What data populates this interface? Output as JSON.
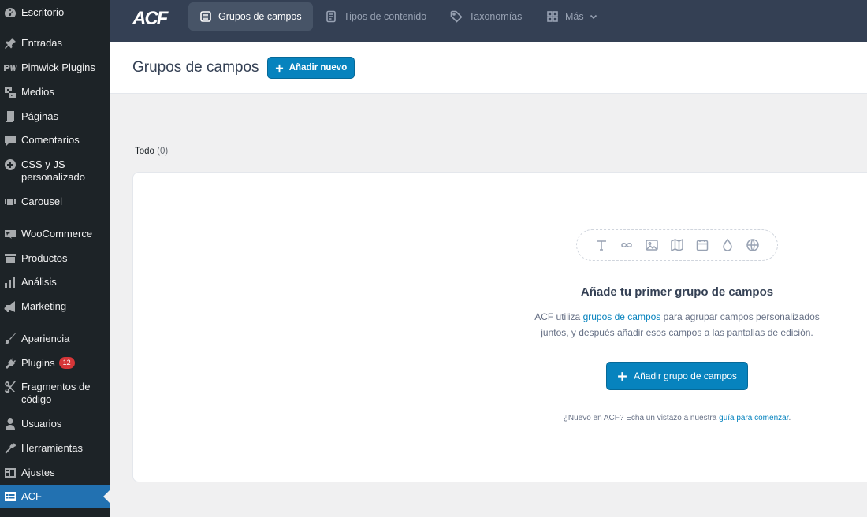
{
  "sidebar": {
    "items": [
      {
        "label": "Escritorio",
        "icon": "dashboard-icon"
      },
      {
        "label": "Entradas",
        "icon": "pin-icon"
      },
      {
        "label": "Pimwick Plugins",
        "icon": "pw-logo-icon"
      },
      {
        "label": "Medios",
        "icon": "media-icon"
      },
      {
        "label": "Páginas",
        "icon": "pages-icon"
      },
      {
        "label": "Comentarios",
        "icon": "comment-icon"
      },
      {
        "label": "CSS y JS personalizado",
        "icon": "plus-circle-icon"
      },
      {
        "label": "Carousel",
        "icon": "carousel-icon"
      },
      {
        "label": "WooCommerce",
        "icon": "woo-icon"
      },
      {
        "label": "Productos",
        "icon": "archive-icon"
      },
      {
        "label": "Análisis",
        "icon": "chart-bar-icon"
      },
      {
        "label": "Marketing",
        "icon": "megaphone-icon"
      },
      {
        "label": "Apariencia",
        "icon": "brush-icon"
      },
      {
        "label": "Plugins",
        "icon": "plug-icon",
        "badge": "12"
      },
      {
        "label": "Fragmentos de código",
        "icon": "scissors-icon"
      },
      {
        "label": "Usuarios",
        "icon": "user-icon"
      },
      {
        "label": "Herramientas",
        "icon": "wrench-icon"
      },
      {
        "label": "Ajustes",
        "icon": "settings-icon"
      },
      {
        "label": "ACF",
        "icon": "acf-table-icon",
        "active": true
      }
    ]
  },
  "topbar": {
    "logo": "ACF",
    "tabs": [
      {
        "label": "Grupos de campos",
        "icon": "list-icon",
        "active": true
      },
      {
        "label": "Tipos de contenido",
        "icon": "document-icon"
      },
      {
        "label": "Taxonomías",
        "icon": "tag-icon"
      },
      {
        "label": "Más",
        "icon": "grid-icon"
      }
    ]
  },
  "header": {
    "title": "Grupos de campos",
    "add_new_label": "Añadir nuevo"
  },
  "filter": {
    "label": "Todo",
    "count": "(0)"
  },
  "empty_state": {
    "icons": [
      "text-icon",
      "infinity-icon",
      "image-icon",
      "map-icon",
      "calendar-icon",
      "drop-icon",
      "globe-icon"
    ],
    "title": "Añade tu primer grupo de campos",
    "desc_prefix": "ACF utiliza ",
    "desc_link": "grupos de campos",
    "desc_suffix": " para agrupar campos personalizados juntos, y después añadir esos campos a las pantallas de edición.",
    "button_label": "Añadir grupo de campos",
    "note_prefix": "¿Nuevo en ACF? Echa un vistazo a nuestra ",
    "note_link": "guía para comenzar",
    "note_suffix": "."
  },
  "colors": {
    "sidebar_bg": "#1d2327",
    "active_menu": "#2271b1",
    "topbar_bg": "#344054",
    "primary_button": "#0783be",
    "badge": "#d63638"
  }
}
